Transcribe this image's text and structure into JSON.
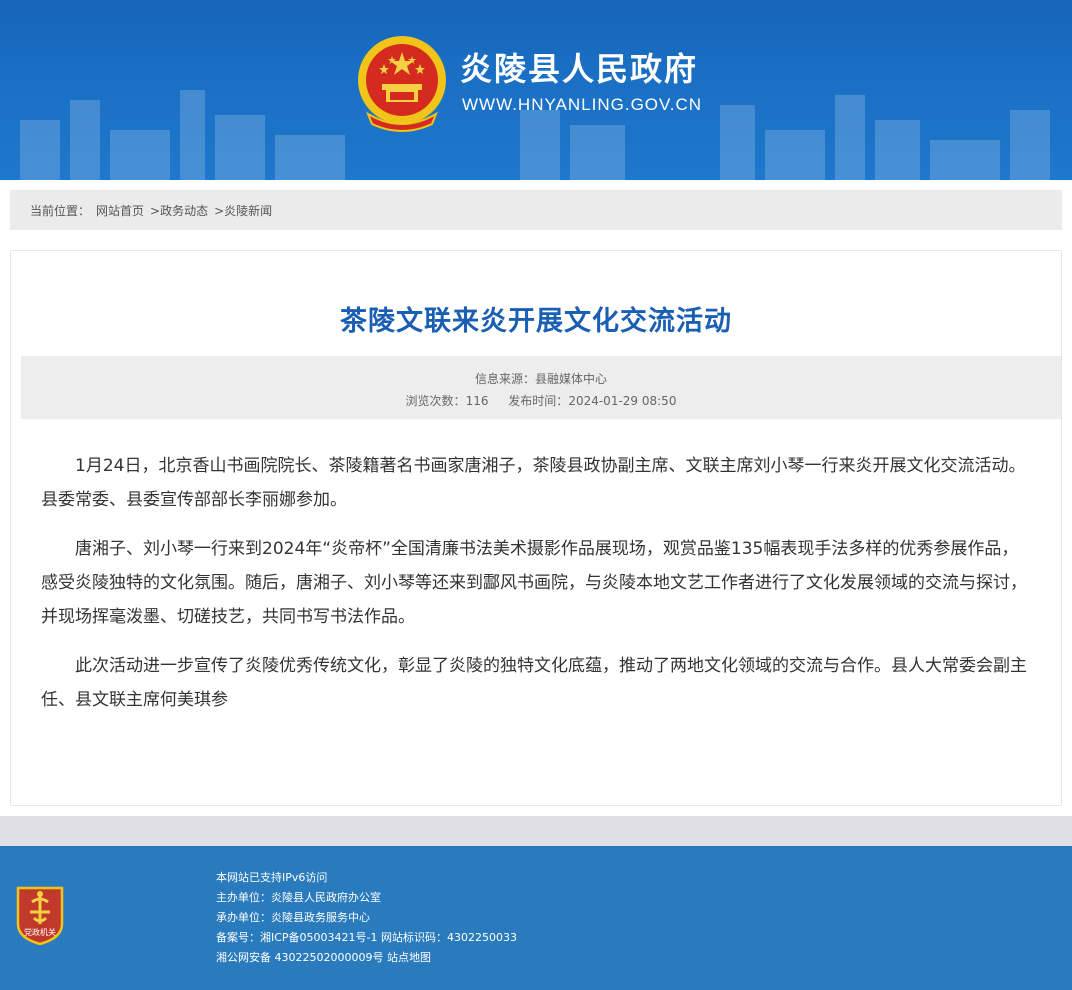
{
  "header": {
    "site_name": "炎陵县人民政府",
    "site_url": "WWW.HNYANLING.GOV.CN",
    "emblem_icon": "national-emblem-icon"
  },
  "breadcrumb": {
    "prefix": "当前位置：",
    "items": [
      "网站首页",
      ">政务动态",
      ">炎陵新闻"
    ]
  },
  "article": {
    "title": "茶陵文联来炎开展文化交流活动",
    "source_label": "信息来源：县融媒体中心",
    "views_label": "浏览次数：",
    "views": "116",
    "published_label": "发布时间：",
    "published": "2024-01-29 08:50",
    "paragraphs": [
      "1月24日，北京香山书画院院长、茶陵籍著名书画家唐湘子，茶陵县政协副主席、文联主席刘小琴一行来炎开展文化交流活动。县委常委、县委宣传部部长李丽娜参加。",
      "唐湘子、刘小琴一行来到2024年“炎帝杯”全国清廉书法美术摄影作品展现场，观赏品鉴135幅表现手法多样的优秀参展作品，感受炎陵独特的文化氛围。随后，唐湘子、刘小琴等还来到酃风书画院，与炎陵本地文艺工作者进行了文化发展领域的交流与探讨，并现场挥毫泼墨、切磋技艺，共同书写书法作品。",
      "此次活动进一步宣传了炎陵优秀传统文化，彰显了炎陵的独特文化底蕴，推动了两地文化领域的交流与合作。县人大常委会副主任、县文联主席何美琪参"
    ]
  },
  "footer": {
    "badge_icon": "party-government-badge-icon",
    "badge_text": "党政机关",
    "lines": [
      "本网站已支持IPv6访问",
      "主办单位：炎陵县人民政府办公室",
      "承办单位：炎陵县政务服务中心",
      "备案号：湘ICP备05003421号-1 网站标识码：4302250033",
      "湘公网安备 43022502000009号 站点地图"
    ]
  },
  "colors": {
    "header_blue": "#1a6fc4",
    "title_blue": "#1a5fb4",
    "footer_blue": "#2a7bbd",
    "badge_red": "#c0392b"
  }
}
